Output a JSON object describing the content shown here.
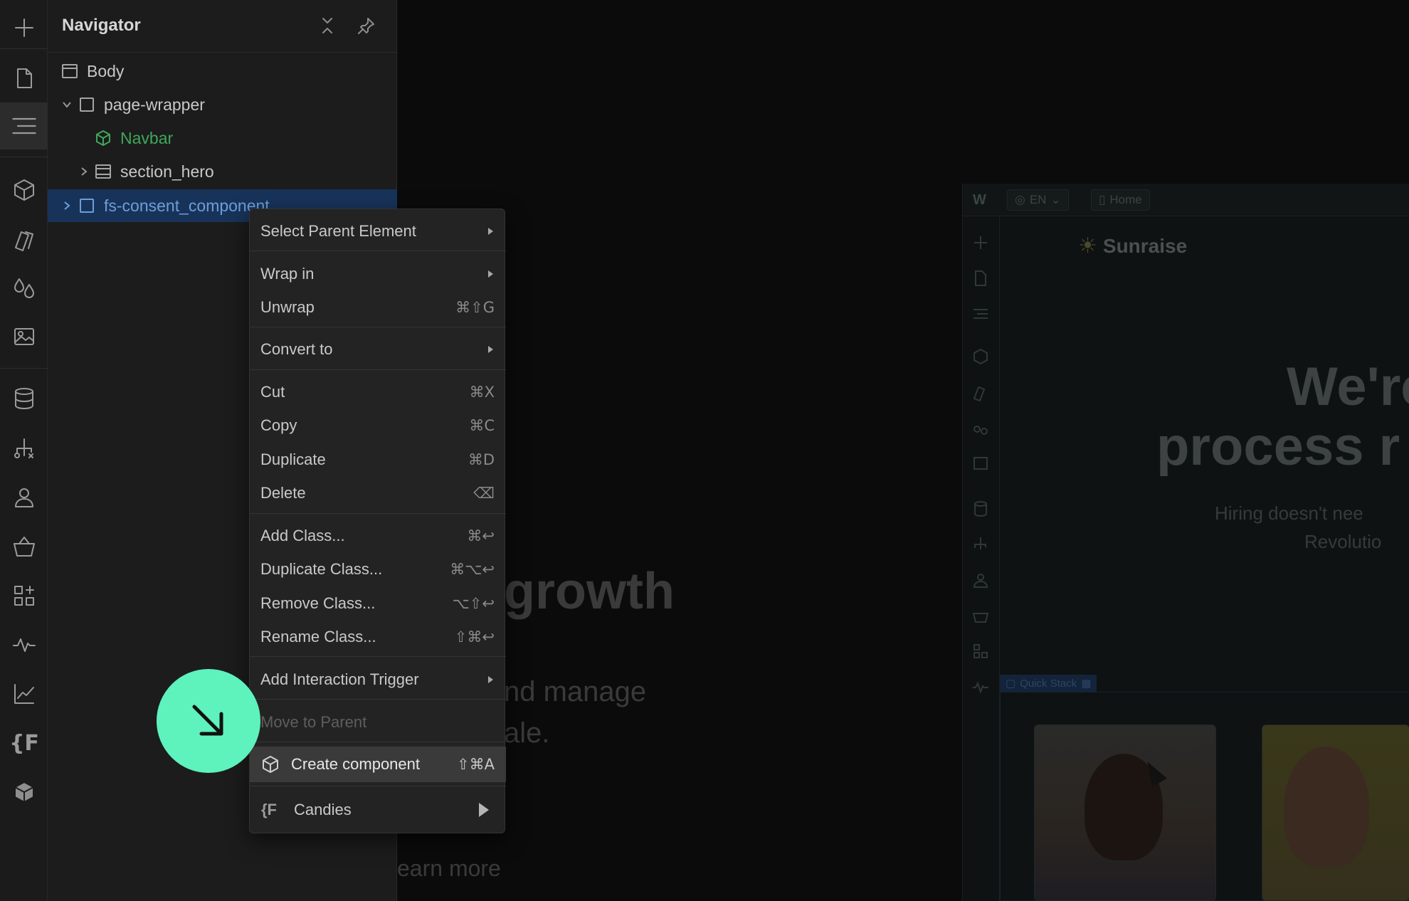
{
  "navigator": {
    "title": "Navigator",
    "tree": [
      {
        "label": "Body"
      },
      {
        "label": "page-wrapper"
      },
      {
        "label": "Navbar"
      },
      {
        "label": "section_hero"
      },
      {
        "label": "fs-consent_component"
      }
    ]
  },
  "canvas": {
    "heading_fragment": "growth",
    "sub_fragment_1": "nd manage",
    "sub_fragment_2": "ale.",
    "link_fragment": "earn more",
    "inner": {
      "lang": "EN",
      "page": "Home",
      "brand": "Sunraise",
      "hero_line_1": "We're",
      "hero_line_2": "process r",
      "sub_line_1": "Hiring doesn't nee",
      "sub_line_2": "Revolutio",
      "stack_label": "Quick Stack"
    }
  },
  "context_menu": {
    "select_parent": "Select Parent Element",
    "wrap_in": "Wrap in",
    "unwrap": "Unwrap",
    "unwrap_key": "⌘⇧G",
    "convert_to": "Convert to",
    "cut": "Cut",
    "cut_key": "⌘X",
    "copy": "Copy",
    "copy_key": "⌘C",
    "duplicate": "Duplicate",
    "duplicate_key": "⌘D",
    "delete": "Delete",
    "delete_key": "⌫",
    "add_class": "Add Class...",
    "add_class_key": "⌘↩",
    "duplicate_class": "Duplicate Class...",
    "duplicate_class_key": "⌘⌥↩",
    "remove_class": "Remove Class...",
    "remove_class_key": "⌥⇧↩",
    "rename_class": "Rename Class...",
    "rename_class_key": "⇧⌘↩",
    "add_interaction": "Add Interaction Trigger",
    "move_to_parent": "Move to Parent",
    "create_component": "Create component",
    "create_component_key": "⇧⌘A",
    "candies": "Candies"
  },
  "rail_icons": [
    "add-icon",
    "page-icon",
    "navigator-icon",
    "components-icon",
    "styles-icon",
    "variables-icon",
    "assets-icon",
    "cms-icon",
    "logic-icon",
    "users-icon",
    "ecommerce-icon",
    "apps-icon",
    "activity-icon",
    "analytics-icon",
    "finsweet-icon",
    "package-icon"
  ],
  "colors": {
    "accent_blue": "#18335a",
    "component_green": "#3fa75a",
    "cursor_mint": "#5ef2bd"
  }
}
